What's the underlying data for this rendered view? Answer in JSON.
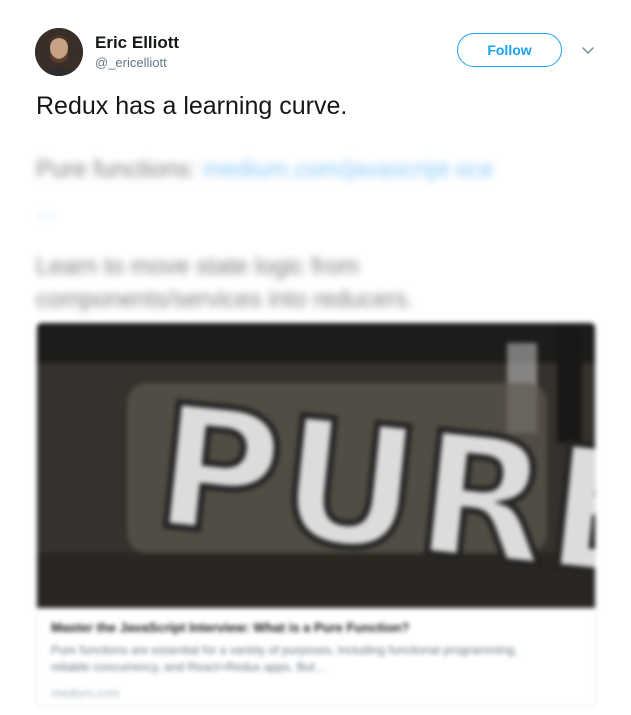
{
  "author": {
    "name": "Eric Elliott",
    "handle": "@_ericelliott"
  },
  "actions": {
    "follow_label": "Follow",
    "menu_icon": "chevron-down-icon"
  },
  "tweet": {
    "text": "Redux has a learning curve.",
    "blurred_line1_text": "Pure functions:",
    "blurred_line1_link": "medium.com/javascript-sce",
    "blurred_line2": "...",
    "blurred_line3": "Learn to move state logic from",
    "blurred_line4": "components/services into reducers."
  },
  "card": {
    "image_text": "PURE",
    "title": "Master the JavaScript Interview: What is a Pure Function?",
    "description": "Pure functions are essential for a variety of purposes, including functional programming, reliable concurrency, and React+Redux apps. But…",
    "domain": "medium.com"
  },
  "colors": {
    "accent": "#1da1f2",
    "text": "#14171a",
    "secondary": "#657786"
  }
}
